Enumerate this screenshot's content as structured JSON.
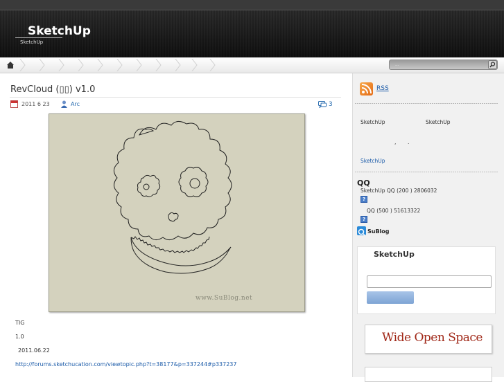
{
  "header": {
    "site_title": "SketchUp",
    "site_subtitle": "SketchUp"
  },
  "nav": {
    "search_placeholder": "..."
  },
  "post": {
    "title": "RevCloud (▯▯) v1.0",
    "date": "2011 6 23",
    "author": "Arc",
    "comment_count": "3",
    "image_watermark": "www.SuBlog.net",
    "body_lines": [
      "TIG",
      "1.0",
      "2011.06.22"
    ],
    "link": "http://forums.sketchucation.com/viewtopic.php?t=38177&p=337244#p337237"
  },
  "sidebar": {
    "rss_label": "RSS",
    "text_a": "SketchUp",
    "text_b": "SketchUp",
    "text_c": ",",
    "text_d": ".",
    "link_sketchup": "SketchUp",
    "qq_title": "QQ",
    "qq_line1": "SketchUp QQ   (200 ) 2806032",
    "qq_line2": "QQ   (500 ) 51613322",
    "sublog_label": "SuBlog",
    "search_box_title": "SketchUp",
    "banner_text": "Wide Open Space"
  },
  "colors": {
    "link": "#1a5aa8",
    "header_bg": "#1a1a1a",
    "rss": "#e46a14"
  },
  "icons": [
    "home-icon",
    "search-icon",
    "calendar-icon",
    "user-icon",
    "comment-icon",
    "rss-icon",
    "qq-icon",
    "sublog-icon"
  ]
}
